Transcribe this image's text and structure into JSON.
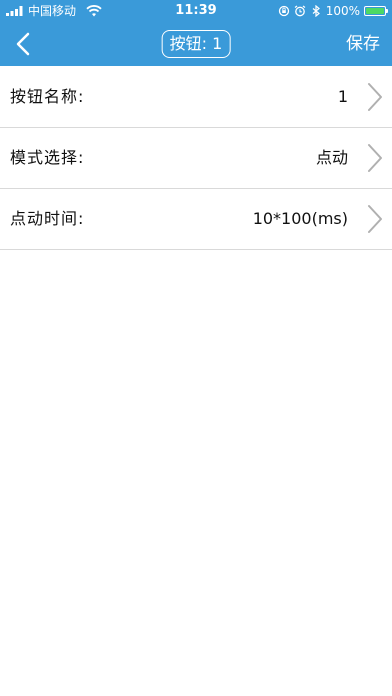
{
  "status_bar": {
    "carrier": "中国移动",
    "time": "11:39",
    "battery_percent": "100%",
    "battery_level": 1.0,
    "icons": [
      "signal-icon",
      "wifi-icon",
      "rotation-lock-icon",
      "alarm-icon",
      "bluetooth-icon",
      "battery-icon"
    ]
  },
  "nav": {
    "title": "按钮: 1",
    "save_label": "保存",
    "back_icon": "chevron-left-icon"
  },
  "rows": [
    {
      "label": "按钮名称:",
      "value": "1"
    },
    {
      "label": "模式选择:",
      "value": "点动"
    },
    {
      "label": "点动时间:",
      "value": "10*100(ms)"
    }
  ],
  "colors": {
    "header_bg": "#3a9ad9",
    "battery_fill": "#4cd964",
    "divider": "#d9d9d9",
    "chevron": "#b0b0b0"
  }
}
